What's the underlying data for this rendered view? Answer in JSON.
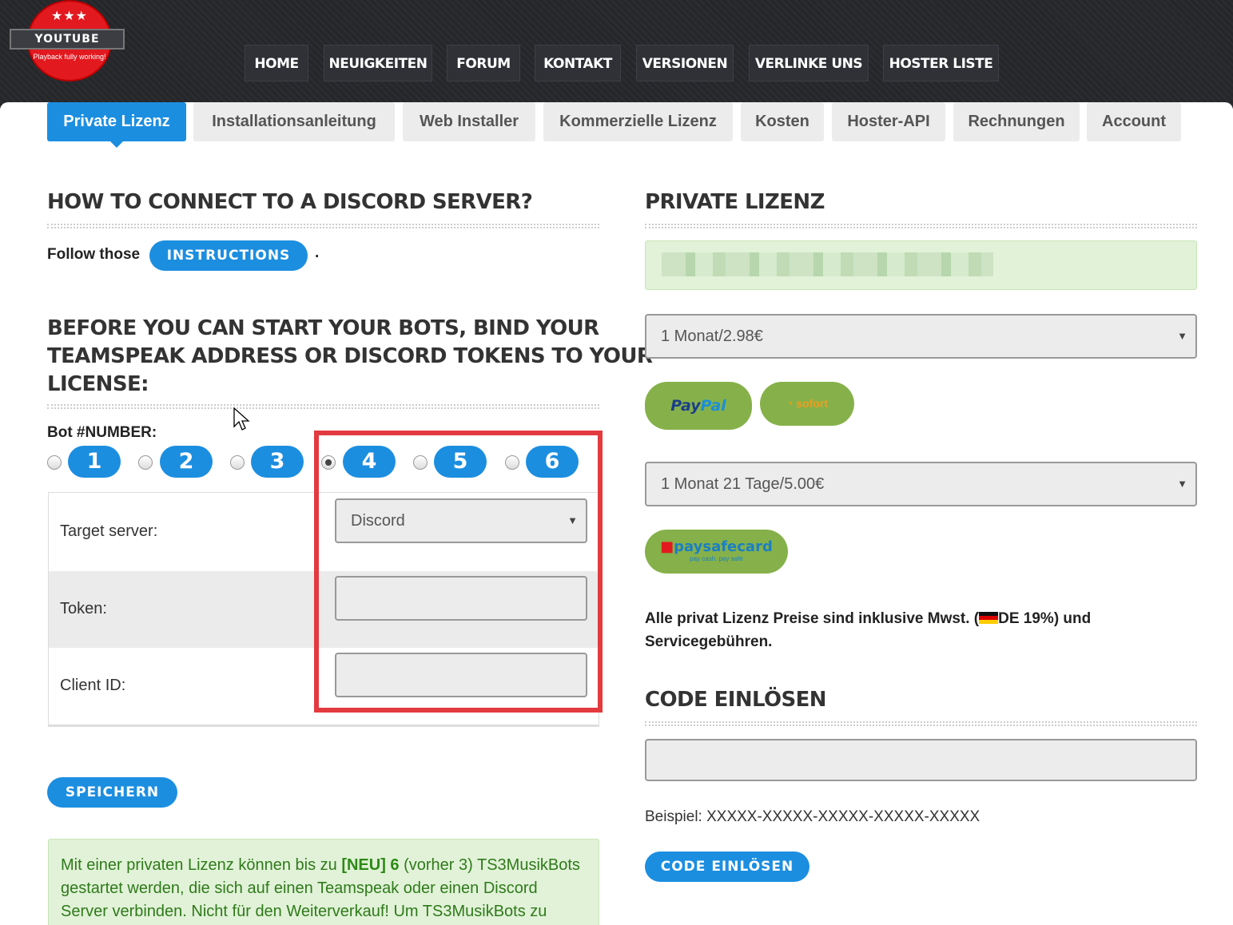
{
  "brand": {
    "stars": "★★★",
    "name": "YOUTUBE",
    "tagline": "Playback fully working!"
  },
  "mainnav": [
    "HOME",
    "NEUIGKEITEN",
    "FORUM",
    "KONTAKT",
    "VERSIONEN",
    "VERLINKE UNS",
    "HOSTER LISTE"
  ],
  "tabs": [
    "Private Lizenz",
    "Installationsanleitung",
    "Web Installer",
    "Kommerzielle Lizenz",
    "Kosten",
    "Hoster-API",
    "Rechnungen",
    "Account"
  ],
  "left": {
    "connect_heading": "HOW TO CONNECT TO A DISCORD SERVER?",
    "follow_text": "Follow those",
    "instructions_label": "INSTRUCTIONS",
    "period": ".",
    "bind_heading_lines": [
      "BEFORE YOU CAN START YOUR BOTS, BIND YOUR",
      "TEAMSPEAK ADDRESS OR DISCORD TOKENS TO YOUR",
      "LICENSE:"
    ],
    "bot_label": "Bot #NUMBER:",
    "bots": [
      "1",
      "2",
      "3",
      "4",
      "5",
      "6"
    ],
    "selected_bot": "4",
    "target_label": "Target server:",
    "target_value": "Discord",
    "token_label": "Token:",
    "token_value": "",
    "client_label": "Client ID:",
    "client_value": "",
    "save_label": "SPEICHERN",
    "notice_pre": "Mit einer privaten Lizenz können bis zu ",
    "notice_bold": "[NEU] 6",
    "notice_post": " (vorher 3) TS3MusikBots gestartet werden, die sich auf einen Teamspeak oder einen Discord Server verbinden. Nicht für den Weiterverkauf! Um TS3MusikBots zu"
  },
  "right": {
    "private_heading": "PRIVATE LIZENZ",
    "plan1": "1 Monat/2.98€",
    "paypal_a": "Pay",
    "paypal_b": "Pal",
    "sofort": "sofort",
    "plan2": "1 Monat 21 Tage/5.00€",
    "paysafe": "paysafecard",
    "paysafe_sub": "pay cash. pay safe",
    "tax_pre": "Alle privat Lizenz Preise sind inklusive Mwst. (",
    "tax_post": "DE 19%) und",
    "tax_line2": "Servicegebühren.",
    "code_heading": "CODE EINLÖSEN",
    "code_value": "",
    "example": "Beispiel: XXXXX-XXXXX-XXXXX-XXXXX-XXXXX",
    "redeem_label": "CODE EINLÖSEN"
  },
  "colors": {
    "accent": "#1c8ee0",
    "highlight_box": "#e33a3f",
    "pay_green": "#86b14a"
  }
}
